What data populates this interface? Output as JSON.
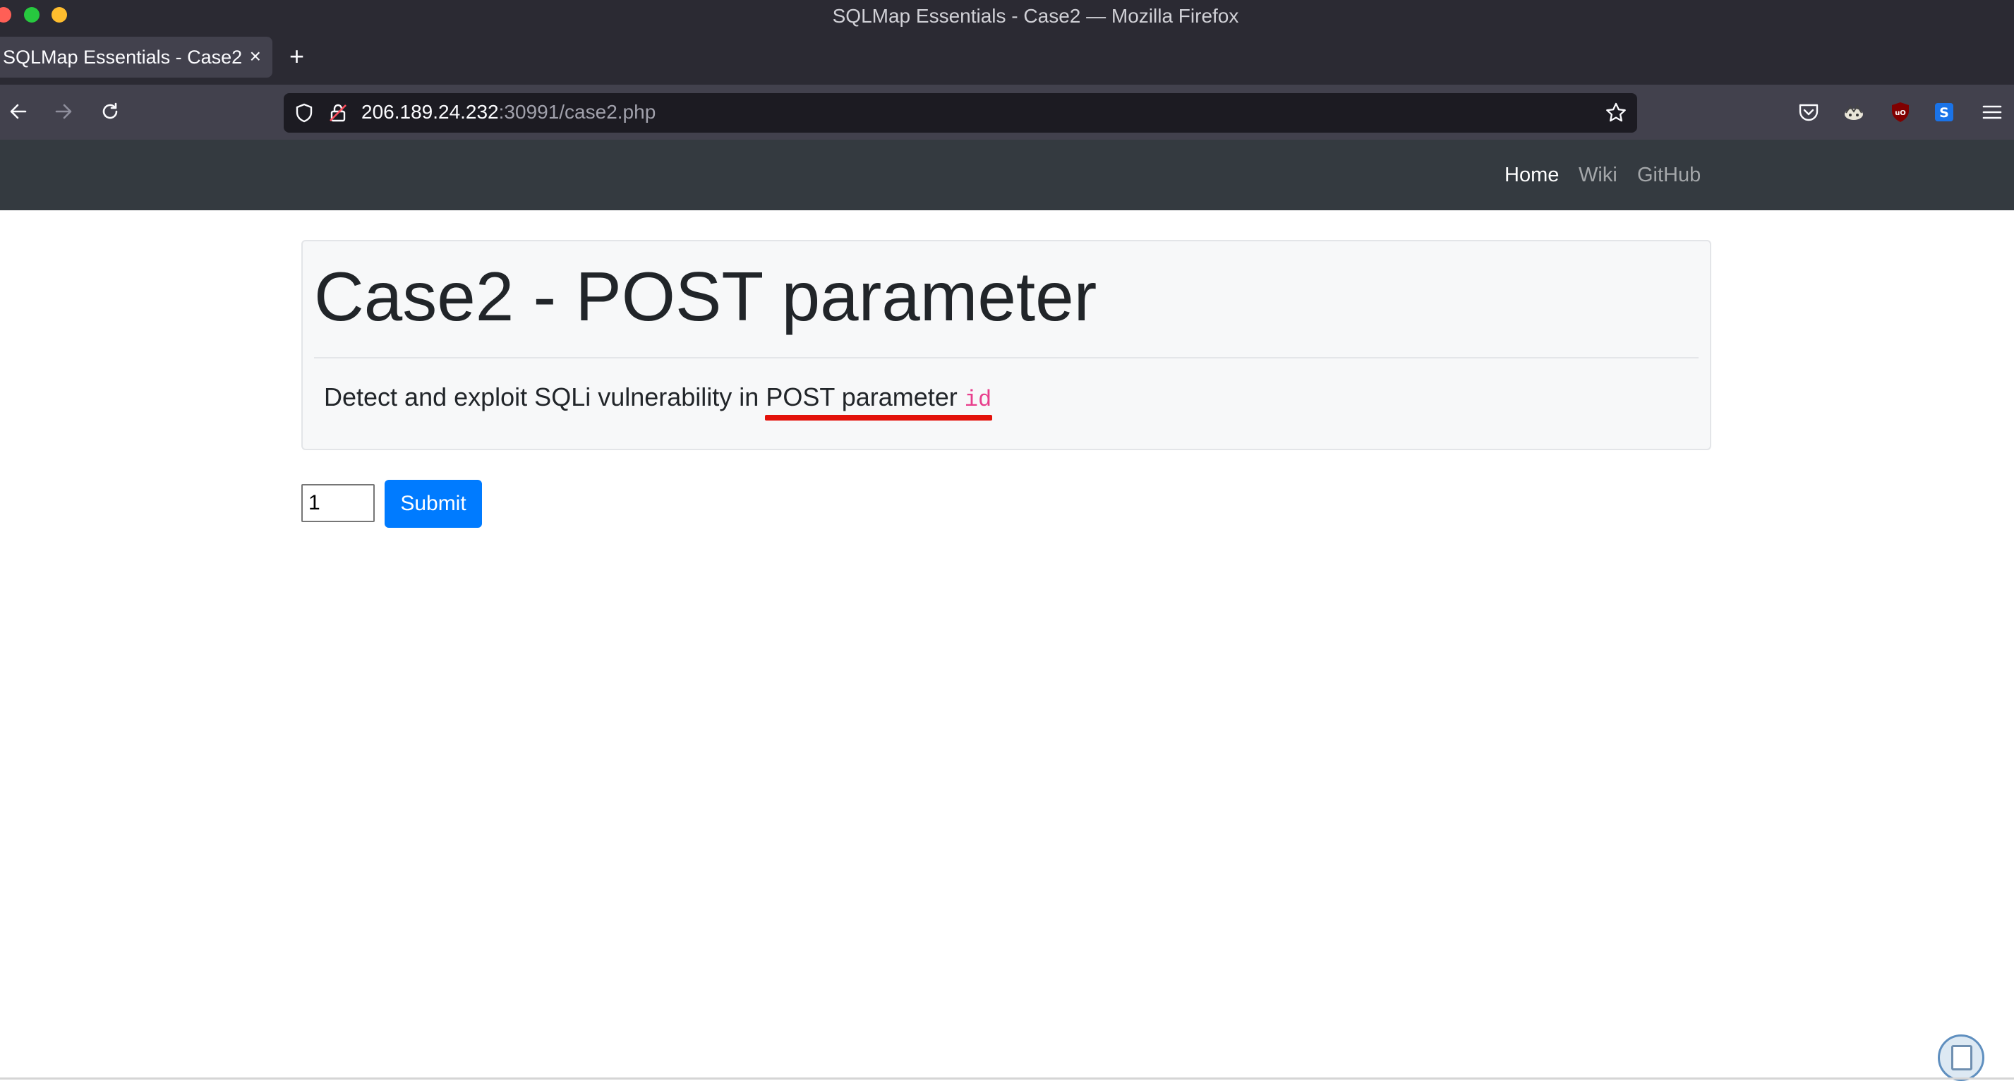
{
  "window": {
    "title": "SQLMap Essentials - Case2 — Mozilla Firefox"
  },
  "tabs": [
    {
      "label": "SQLMap Essentials - Case2",
      "close": "×"
    }
  ],
  "new_tab_label": "+",
  "url": {
    "host": "206.189.24.232",
    "rest": ":30991/case2.php"
  },
  "site_nav": {
    "items": [
      "Home",
      "Wiki",
      "GitHub"
    ],
    "active": "Home"
  },
  "jumbotron": {
    "title": "Case2 - POST parameter",
    "lead_text": "Detect and exploit SQLi vulnerability in POST parameter ",
    "lead_code": "id"
  },
  "form": {
    "id_value": "1",
    "submit_label": "Submit"
  },
  "colors": {
    "primary_button": "#007bff",
    "header_bg": "#343a40",
    "code_color": "#e83e8c",
    "annotation_underline": "#e3120b"
  },
  "icons": [
    "back-arrow-icon",
    "forward-arrow-icon",
    "reload-icon",
    "shield-icon",
    "insecure-lock-icon",
    "star-bookmark-icon",
    "pocket-icon",
    "extension-icon",
    "ublock-icon",
    "s-extension-icon",
    "hamburger-menu-icon",
    "clipboard-icon"
  ]
}
